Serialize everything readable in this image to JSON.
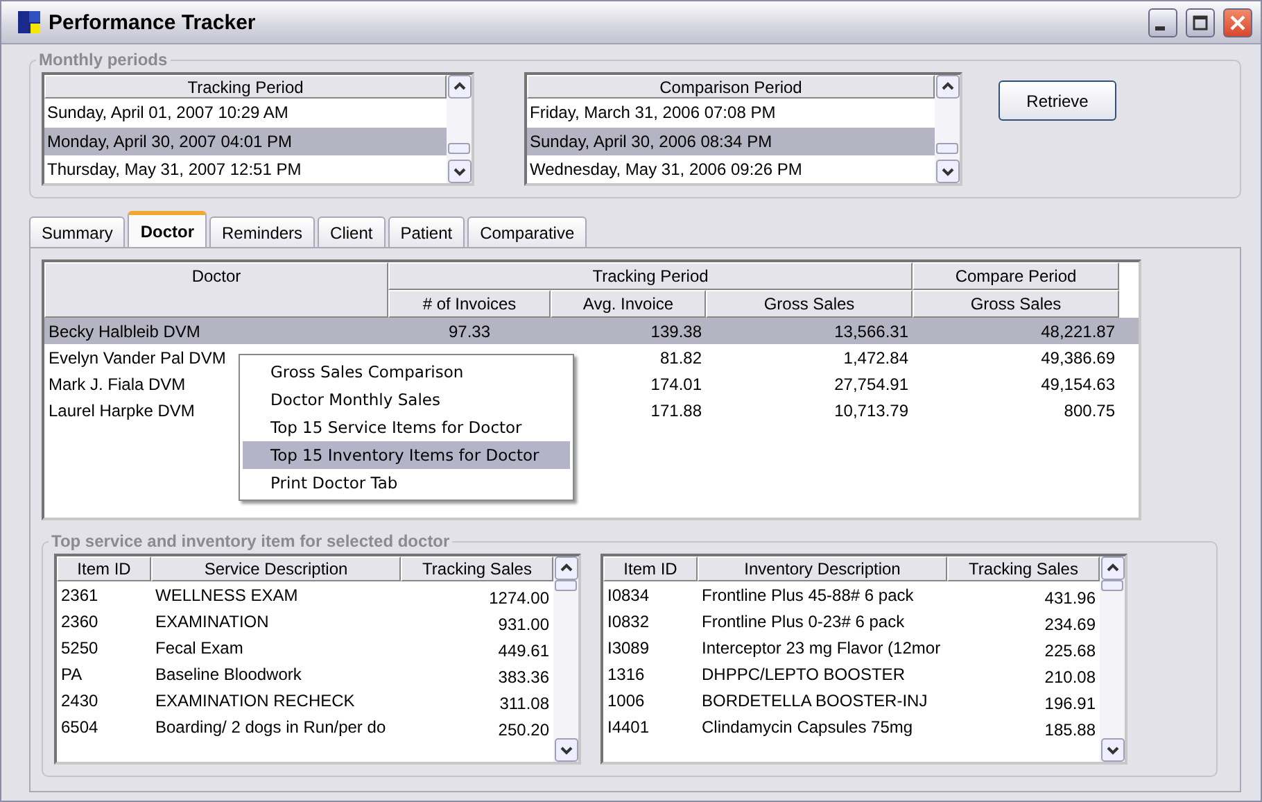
{
  "window": {
    "title": "Performance Tracker"
  },
  "monthly_periods": {
    "title": "Monthly periods",
    "tracking": {
      "header": "Tracking Period",
      "items": [
        {
          "label": "Sunday, April 01, 2007 10:29 AM",
          "selected": false
        },
        {
          "label": "Monday, April 30, 2007 04:01 PM",
          "selected": true
        },
        {
          "label": "Thursday, May 31, 2007 12:51 PM",
          "selected": false
        }
      ]
    },
    "comparison": {
      "header": "Comparison Period",
      "items": [
        {
          "label": "Friday, March 31, 2006 07:08 PM",
          "selected": false
        },
        {
          "label": "Sunday, April 30, 2006 08:34 PM",
          "selected": true
        },
        {
          "label": "Wednesday, May 31, 2006 09:26 PM",
          "selected": false
        }
      ]
    },
    "retrieve_button": "Retrieve"
  },
  "tabs": [
    {
      "label": "Summary",
      "selected": false
    },
    {
      "label": "Doctor",
      "selected": true
    },
    {
      "label": "Reminders",
      "selected": false
    },
    {
      "label": "Client",
      "selected": false
    },
    {
      "label": "Patient",
      "selected": false
    },
    {
      "label": "Comparative",
      "selected": false
    }
  ],
  "doctor_table": {
    "groups": [
      "Tracking Period",
      "Compare Period"
    ],
    "columns": [
      "Doctor",
      "# of Invoices",
      "Avg. Invoice",
      "Gross Sales",
      "Gross Sales"
    ],
    "rows": [
      {
        "cells": [
          "Becky Halbleib DVM",
          "97.33",
          "139.38",
          "13,566.31",
          "48,221.87"
        ],
        "selected": true
      },
      {
        "cells": [
          "Evelyn Vander Pal DVM",
          null,
          "81.82",
          "1,472.84",
          "49,386.69"
        ],
        "selected": false
      },
      {
        "cells": [
          "Mark J. Fiala DVM",
          null,
          "174.01",
          "27,754.91",
          "49,154.63"
        ],
        "selected": false
      },
      {
        "cells": [
          "Laurel Harpke DVM",
          null,
          "171.88",
          "10,713.79",
          "800.75"
        ],
        "selected": false
      }
    ]
  },
  "context_menu": {
    "items": [
      {
        "label": "Gross Sales Comparison",
        "selected": false
      },
      {
        "label": "Doctor Monthly Sales",
        "selected": false
      },
      {
        "label": "Top 15 Service Items for Doctor",
        "selected": false
      },
      {
        "label": "Top 15 Inventory Items for Doctor",
        "selected": true
      },
      {
        "label": "Print Doctor Tab",
        "selected": false
      }
    ]
  },
  "top_items": {
    "title": "Top service and inventory item for selected doctor",
    "service_list": {
      "columns": [
        "Item ID",
        "Service Description",
        "Tracking Sales"
      ],
      "rows": [
        [
          "2361",
          "WELLNESS EXAM",
          "1274.00"
        ],
        [
          "2360",
          "EXAMINATION",
          "931.00"
        ],
        [
          "5250",
          "Fecal Exam",
          "449.61"
        ],
        [
          "PA",
          "Baseline Bloodwork",
          "383.36"
        ],
        [
          "2430",
          "EXAMINATION RECHECK",
          "311.08"
        ],
        [
          "6504",
          "Boarding/ 2 dogs in Run/per do",
          "250.20"
        ]
      ]
    },
    "inventory_list": {
      "columns": [
        "Item ID",
        "Inventory Description",
        "Tracking Sales"
      ],
      "rows": [
        [
          "I0834",
          "Frontline Plus 45-88# 6 pack",
          "431.96"
        ],
        [
          "I0832",
          "Frontline Plus 0-23# 6 pack",
          "234.69"
        ],
        [
          "I3089",
          "Interceptor 23 mg Flavor (12mor",
          "225.68"
        ],
        [
          "1316",
          "DHPPC/LEPTO BOOSTER",
          "210.08"
        ],
        [
          "1006",
          "BORDETELLA BOOSTER-INJ",
          "196.91"
        ],
        [
          "I4401",
          "Clindamycin Capsules 75mg",
          "185.88"
        ]
      ]
    }
  }
}
